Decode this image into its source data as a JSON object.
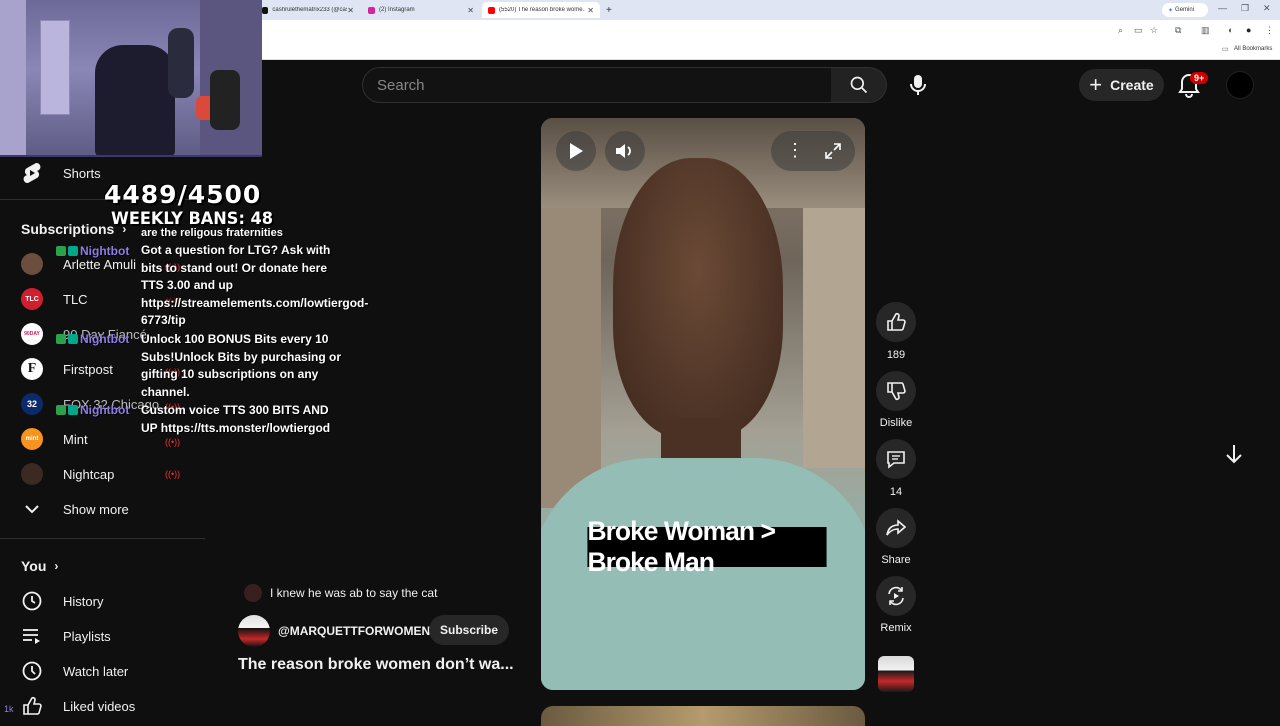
{
  "browser": {
    "tabs": [
      {
        "label": "cashrulethematrix233 (@cashru...",
        "active": false
      },
      {
        "label": "(2) Instagram",
        "active": false
      },
      {
        "label": "(5520) The reason broke wome...",
        "active": true
      }
    ],
    "new_tab": "+",
    "gemini_label": "Gemini",
    "bookmarks_label": "All Bookmarks"
  },
  "header": {
    "search_placeholder": "Search",
    "create_label": "Create",
    "notif_count": "9+"
  },
  "sidebar": {
    "shorts_label": "Shorts",
    "subscriptions_title": "Subscriptions",
    "channels": [
      {
        "name": "Arlette Amuli",
        "live": true,
        "avatar_text": ""
      },
      {
        "name": "TLC",
        "live": true,
        "avatar_text": "TLC"
      },
      {
        "name": "90 Day Fiancé",
        "live": false,
        "avatar_text": "90DAY"
      },
      {
        "name": "Firstpost",
        "live": true,
        "avatar_text": "F"
      },
      {
        "name": "FOX 32 Chicago",
        "live": true,
        "avatar_text": "32"
      },
      {
        "name": "Mint",
        "live": true,
        "avatar_text": "mint"
      },
      {
        "name": "Nightcap",
        "live": true,
        "avatar_text": ""
      }
    ],
    "show_more": "Show more",
    "you_title": "You",
    "you_items": [
      {
        "label": "History",
        "icon": "history-icon"
      },
      {
        "label": "Playlists",
        "icon": "playlists-icon"
      },
      {
        "label": "Watch later",
        "icon": "watch-later-icon"
      },
      {
        "label": "Liked videos",
        "icon": "liked-videos-icon"
      }
    ]
  },
  "overlay": {
    "counter": "4489/4500",
    "weekly_bans": "WEEKLY BANS: 48",
    "bot_name": "Nightbot",
    "chat_fragment": "are the religous fraternities",
    "chat_messages": [
      "Got a question for LTG? Ask with bits to stand out! Or donate here TTS 3.00 and up https://streamelements.com/lowtiergod-6773/tip",
      "Unlock 100 BONUS Bits every 10 Subs!Unlock Bits by purchasing or gifting 10 subscriptions on any channel.",
      "Custom voice TTS 300 BITS AND UP https://tts.monster/lowtiergod"
    ],
    "corner_tag": "1k"
  },
  "video": {
    "caption": "Broke Woman > Broke Man",
    "comment_preview": "I knew he was ab to say the cat",
    "channel": "@MARQUETTFORWOMEN",
    "subscribe_label": "Subscribe",
    "title": "The reason broke women don’t wa..."
  },
  "actions": {
    "likes": "189",
    "dislike_label": "Dislike",
    "comments": "14",
    "share_label": "Share",
    "remix_label": "Remix"
  },
  "colors": {
    "background": "#0f0f0f",
    "live_red": "#e33333",
    "bot_purple": "#8f7de6",
    "chip": "#272727"
  }
}
